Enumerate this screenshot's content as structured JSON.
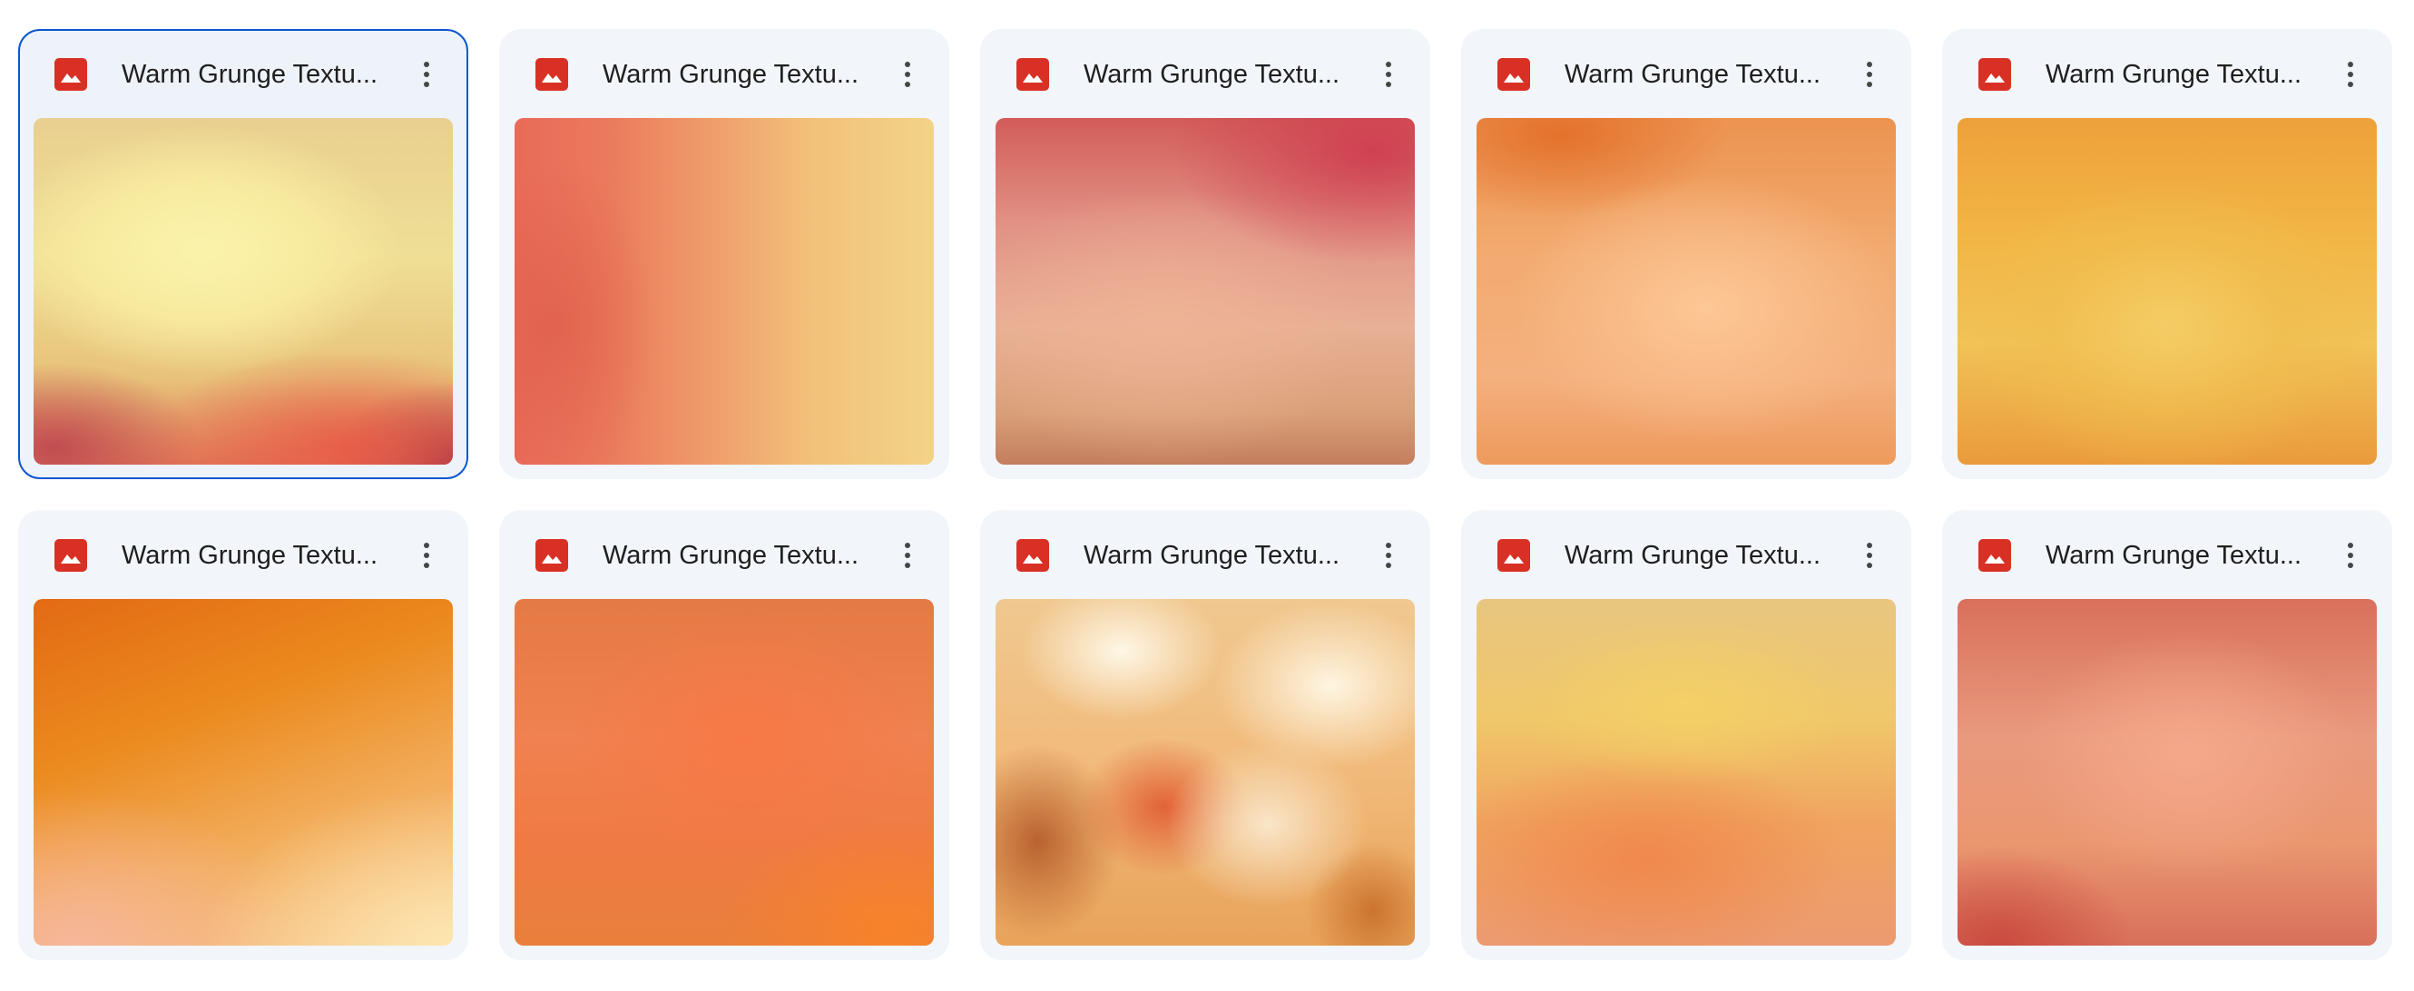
{
  "grid": {
    "items": [
      {
        "name": "Warm Grunge Textu...",
        "file_type_icon": "image-file-icon",
        "menu_icon": "more-vert-icon",
        "thumbnail": "warm orange grunge texture, pale yellow center with red edges",
        "selected": true
      },
      {
        "name": "Warm Grunge Textu...",
        "file_type_icon": "image-file-icon",
        "menu_icon": "more-vert-icon",
        "thumbnail": "red to yellow horizontal grunge texture",
        "selected": false
      },
      {
        "name": "Warm Grunge Textu...",
        "file_type_icon": "image-file-icon",
        "menu_icon": "more-vert-icon",
        "thumbnail": "crimson to peach grunge texture",
        "selected": false
      },
      {
        "name": "Warm Grunge Textu...",
        "file_type_icon": "image-file-icon",
        "menu_icon": "more-vert-icon",
        "thumbnail": "light orange cloudy grunge texture",
        "selected": false
      },
      {
        "name": "Warm Grunge Textu...",
        "file_type_icon": "image-file-icon",
        "menu_icon": "more-vert-icon",
        "thumbnail": "golden amber grunge texture",
        "selected": false
      },
      {
        "name": "Warm Grunge Textu...",
        "file_type_icon": "image-file-icon",
        "menu_icon": "more-vert-icon",
        "thumbnail": "orange to cream gradient texture",
        "selected": false
      },
      {
        "name": "Warm Grunge Textu...",
        "file_type_icon": "image-file-icon",
        "menu_icon": "more-vert-icon",
        "thumbnail": "bright orange grunge texture",
        "selected": false
      },
      {
        "name": "Warm Grunge Textu...",
        "file_type_icon": "image-file-icon",
        "menu_icon": "more-vert-icon",
        "thumbnail": "abstract cream and rust painted texture",
        "selected": false
      },
      {
        "name": "Warm Grunge Textu...",
        "file_type_icon": "image-file-icon",
        "menu_icon": "more-vert-icon",
        "thumbnail": "yellow and coral mottled grunge texture",
        "selected": false
      },
      {
        "name": "Warm Grunge Textu...",
        "file_type_icon": "image-file-icon",
        "menu_icon": "more-vert-icon",
        "thumbnail": "salmon red grunge texture",
        "selected": false
      }
    ]
  },
  "colors": {
    "card_background": "#f2f5fa",
    "selected_border": "#0b57d0",
    "image_icon": "#d93025",
    "text": "#1f1f1f",
    "menu_dots": "#444746"
  }
}
